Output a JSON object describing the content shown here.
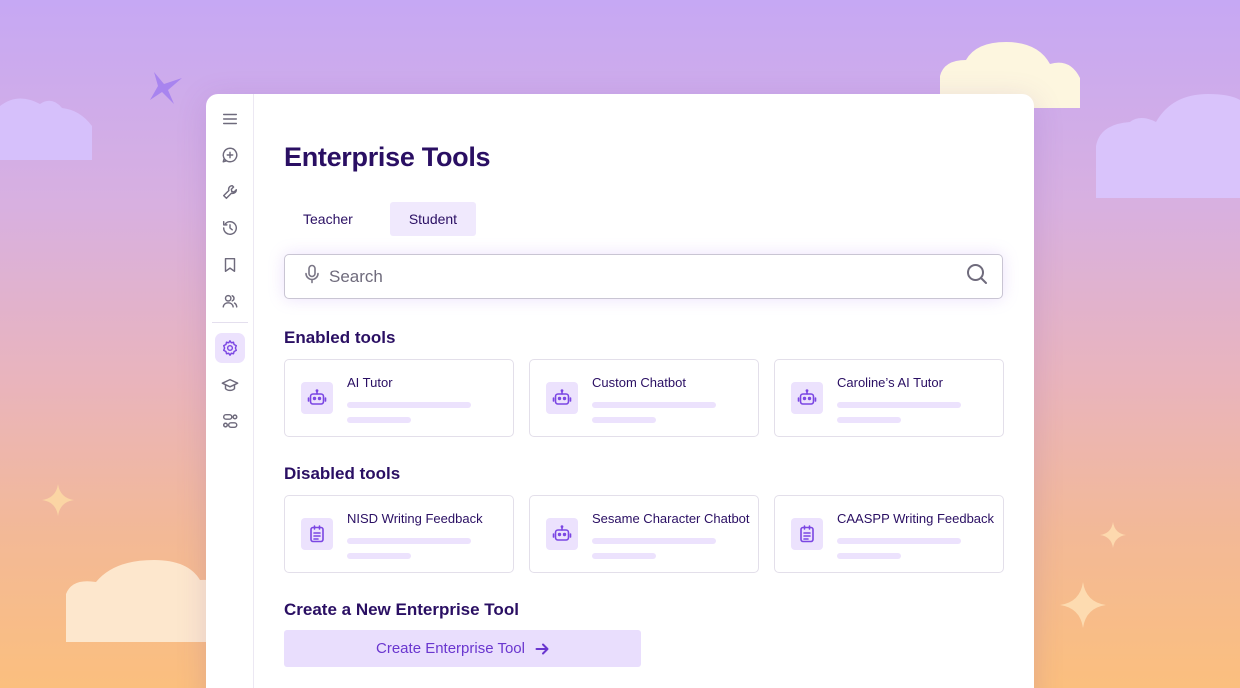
{
  "page": {
    "title": "Enterprise Tools"
  },
  "tabs": [
    {
      "label": "Teacher",
      "active": false
    },
    {
      "label": "Student",
      "active": true
    }
  ],
  "search": {
    "placeholder": "Search",
    "value": ""
  },
  "sections": {
    "enabled": {
      "title": "Enabled tools",
      "tools": [
        {
          "name": "AI Tutor",
          "icon": "robot-icon"
        },
        {
          "name": "Custom Chatbot",
          "icon": "robot-icon"
        },
        {
          "name": "Caroline’s AI Tutor",
          "icon": "robot-icon"
        }
      ]
    },
    "disabled": {
      "title": "Disabled tools",
      "tools": [
        {
          "name": "NISD Writing Feedback",
          "icon": "clipboard-icon"
        },
        {
          "name": "Sesame Character Chatbot",
          "icon": "robot-icon"
        },
        {
          "name": "CAASPP Writing Feedback",
          "icon": "clipboard-icon"
        }
      ]
    },
    "create": {
      "title": "Create a New Enterprise Tool",
      "button_label": "Create Enterprise Tool"
    }
  },
  "sidebar": {
    "items": [
      {
        "icon": "menu-icon"
      },
      {
        "icon": "new-chat-icon"
      },
      {
        "icon": "wrench-icon"
      },
      {
        "icon": "history-icon"
      },
      {
        "icon": "bookmark-icon"
      },
      {
        "icon": "users-icon"
      },
      {
        "icon": "gear-icon",
        "active": true
      },
      {
        "icon": "graduation-cap-icon"
      },
      {
        "icon": "workflow-icon"
      }
    ]
  },
  "colors": {
    "brand_dark": "#2a0f63",
    "accent": "#7b46e3",
    "accent_light": "#ece2fd",
    "button_bg": "#e9defd"
  }
}
